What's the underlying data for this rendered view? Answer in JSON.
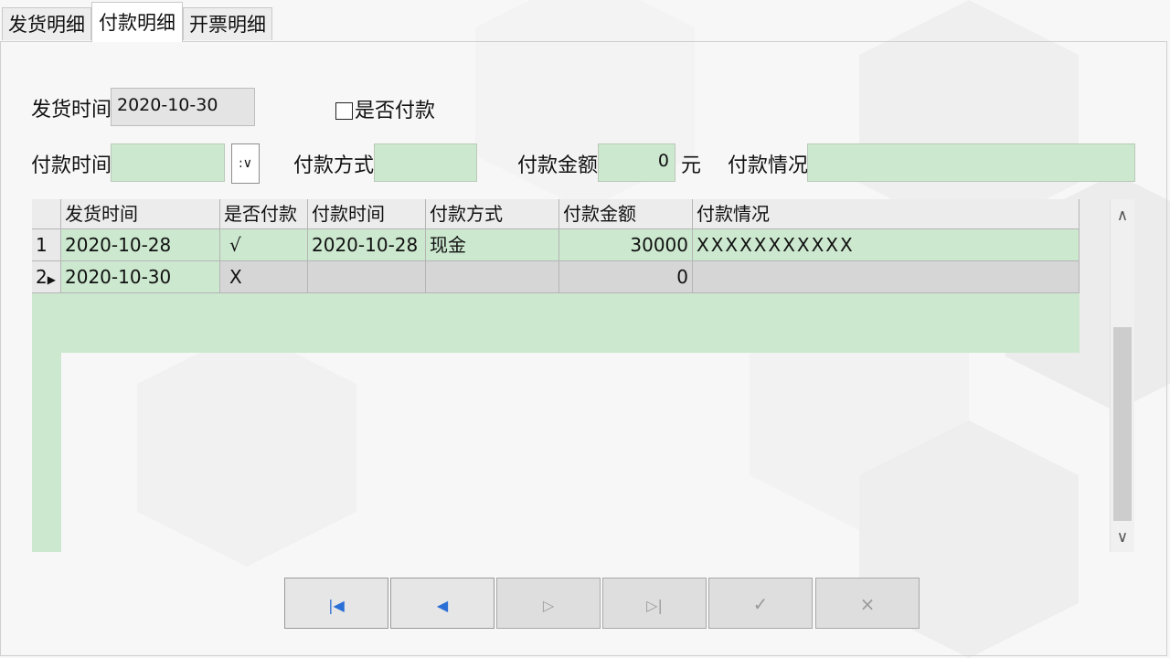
{
  "tabs": [
    {
      "label": "发货明细"
    },
    {
      "label": "付款明细"
    },
    {
      "label": "开票明细"
    }
  ],
  "form": {
    "ship_time_label": "发货时间",
    "ship_time_value": "2020-10-30",
    "is_paid_label": "是否付款",
    "is_paid_checked": false,
    "pay_time_label": "付款时间",
    "pay_time_value": "",
    "pay_time_dropdown": ":∨",
    "pay_method_label": "付款方式",
    "pay_method_value": "",
    "pay_amount_label": "付款金额",
    "pay_amount_value": "0",
    "pay_amount_unit": "元",
    "pay_status_label": "付款情况",
    "pay_status_value": ""
  },
  "table": {
    "columns": [
      "发货时间",
      "是否付款",
      "付款时间",
      "付款方式",
      "付款金额",
      "付款情况"
    ],
    "rows": [
      {
        "index": "1",
        "ship_time": "2020-10-28",
        "paid": "√",
        "pay_time": "2020-10-28",
        "method": "现金",
        "amount": "30000",
        "status": "XXXXXXXXXXX"
      },
      {
        "index": "2",
        "ship_time": "2020-10-30",
        "paid": "X",
        "pay_time": "",
        "method": "",
        "amount": "0",
        "status": ""
      }
    ]
  },
  "scrollbar": {
    "up": "∧",
    "down": "∨"
  },
  "navigator": {
    "first": "|◀",
    "prior": "◀",
    "next": "▷",
    "last": "▷|",
    "post": "✓",
    "cancel": "×"
  },
  "colors": {
    "field_green": "#cce8cf",
    "nav_icon_enabled": "#2a6fd6",
    "nav_icon_disabled": "#9a9a9a"
  }
}
